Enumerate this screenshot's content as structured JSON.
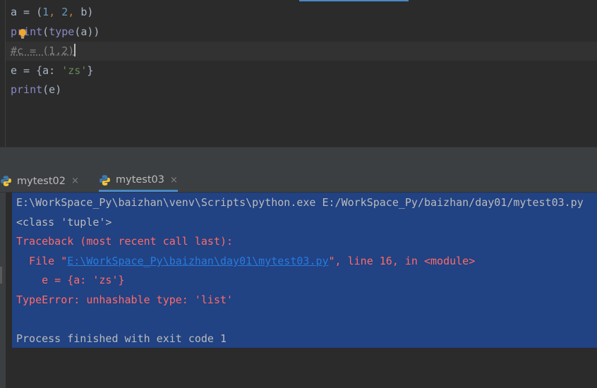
{
  "editor": {
    "line1": {
      "var": "a",
      "eq": " = (",
      "n1": "1",
      "sep1": ", ",
      "n2": "2",
      "sep2": ", ",
      "rest": "b)"
    },
    "line2": {
      "kw": "print",
      "open": "(",
      "fn": "type",
      "rest": "(a))"
    },
    "line3": {
      "comment": "#c = (1,2)"
    },
    "line4": {
      "pre": "e = {a: ",
      "str": "'zs'",
      "post": "}"
    },
    "line5": {
      "kw": "print",
      "rest": "(e)"
    }
  },
  "run": {
    "tabs": [
      {
        "label": "mytest02",
        "close": "×"
      },
      {
        "label": "mytest03",
        "close": "×"
      }
    ],
    "output": {
      "cmd": "E:\\WorkSpace_Py\\baizhan\\venv\\Scripts\\python.exe E:/WorkSpace_Py/baizhan/day01/mytest03.py",
      "result": "<class 'tuple'>",
      "traceback": "Traceback (most recent call last):",
      "file_pre": "  File \"",
      "file_link": "E:\\WorkSpace_Py\\baizhan\\day01\\mytest03.py",
      "file_post": "\", line 16, in <module>",
      "code": "    e = {a: 'zs'}",
      "error": "TypeError: unhashable type: 'list'",
      "blank": "",
      "exit": "Process finished with exit code 1"
    }
  },
  "colors": {
    "background": "#2b2b2b",
    "selection": "#214283",
    "error": "#ff6b68",
    "link": "#287bde",
    "accent": "#4a88c7"
  }
}
